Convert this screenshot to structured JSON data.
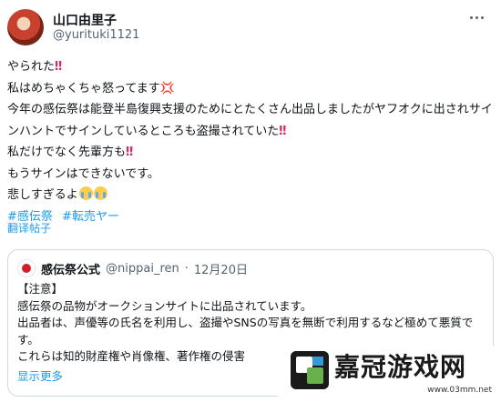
{
  "author": {
    "display_name": "山口由里子",
    "handle": "@yurituki1121",
    "avatar_icon": "profile-photo-icon",
    "more_icon": "more-horizontal-icon"
  },
  "tweet": {
    "lines": [
      "やられた",
      "私はめちゃくちゃ怒ってます",
      "今年の感伝祭は能登半島復興支援のためにとたくさん出品しましたがヤフオクに出されサインハントでサインしているところも盗撮されていた",
      "私だけでなく先輩方も",
      "もうサインはできないです。",
      "悲しすぎるよ"
    ],
    "bang": "‼",
    "anger_mark": "💢",
    "hashtags": [
      "#感伝祭",
      "#転売ヤー"
    ],
    "translate_label": "翻译帖子"
  },
  "quote": {
    "name": "感伝祭公式",
    "handle": "@nippai_ren",
    "separator": "·",
    "date": "12月20日",
    "lines": [
      "【注意】",
      "感伝祭の品物がオークションサイトに出品されています。",
      "出品者は、声優等の氏名を利用し、盗撮やSNSの写真を無断で利用するなど極めて悪質です。",
      "これらは知的財産権や肖像権、著作権の侵害"
    ],
    "show_more_label": "显示更多"
  },
  "watermark": {
    "brand": "嘉冠游戏网",
    "url": "www.03mm.net"
  },
  "colors": {
    "link": "#1d9bf0",
    "text": "#0f1419",
    "muted": "#536471",
    "border": "#cfd9de",
    "bang": "#e0245e"
  }
}
